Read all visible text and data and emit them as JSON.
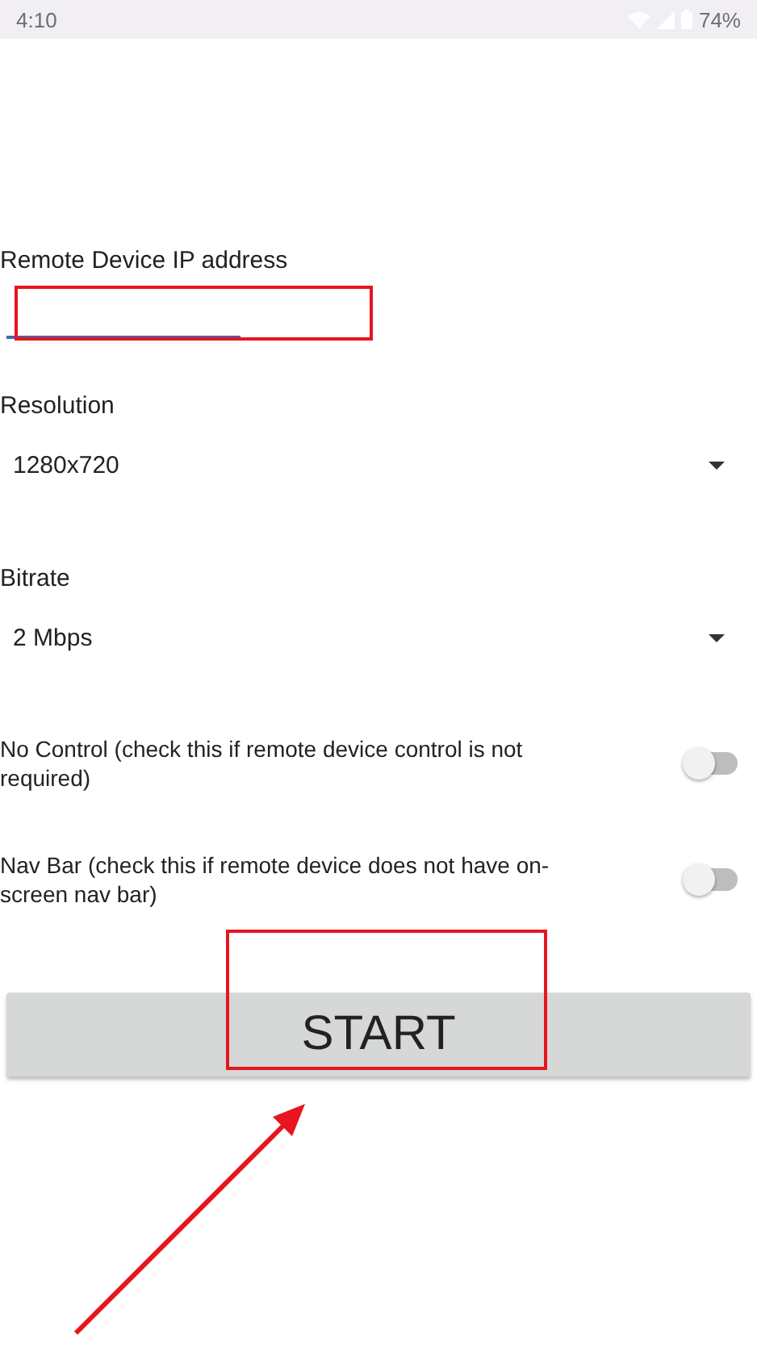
{
  "status_bar": {
    "time": "4:10",
    "battery": "74%"
  },
  "ip_field": {
    "label": "Remote Device IP address"
  },
  "resolution": {
    "label": "Resolution",
    "value": "1280x720"
  },
  "bitrate": {
    "label": "Bitrate",
    "value": "2 Mbps"
  },
  "switches": [
    {
      "label": "No Control (check this if remote device control is not required)",
      "on": false
    },
    {
      "label": "Nav Bar (check this if remote device does not have on-screen nav bar)",
      "on": false
    }
  ],
  "start_button": "START"
}
